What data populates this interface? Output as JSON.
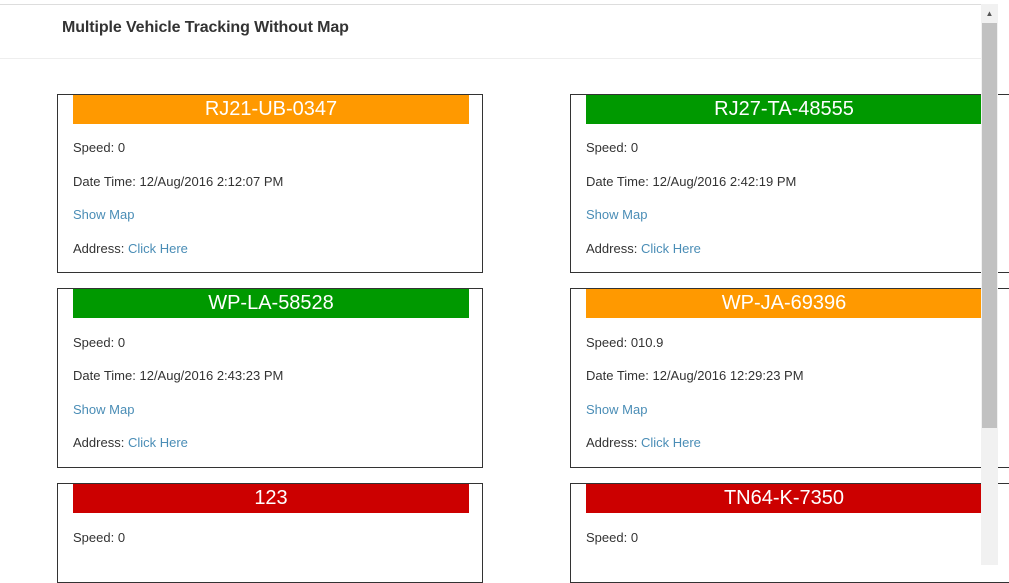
{
  "page": {
    "title": "Multiple Vehicle Tracking Without Map"
  },
  "labels": {
    "speed": "Speed:",
    "date_time": "Date Time:",
    "show_map": "Show Map",
    "address": "Address:",
    "click_here": "Click Here"
  },
  "colors": {
    "orange": "#ff9900",
    "green": "#009900",
    "red": "#cc0000",
    "link": "#4a8db6"
  },
  "vehicles": [
    {
      "id": "RJ21-UB-0347",
      "status_color": "#ff9900",
      "speed": "0",
      "date_time": "12/Aug/2016 2:12:07 PM"
    },
    {
      "id": "RJ27-TA-48555",
      "status_color": "#009900",
      "speed": "0",
      "date_time": "12/Aug/2016 2:42:19 PM"
    },
    {
      "id": "WP-LA-58528",
      "status_color": "#009900",
      "speed": "0",
      "date_time": "12/Aug/2016 2:43:23 PM"
    },
    {
      "id": "WP-JA-69396",
      "status_color": "#ff9900",
      "speed": "010.9",
      "date_time": "12/Aug/2016 12:29:23 PM"
    },
    {
      "id": "123",
      "status_color": "#cc0000",
      "speed": "0"
    },
    {
      "id": "TN64-K-7350",
      "status_color": "#cc0000",
      "speed": "0"
    }
  ],
  "scrollbar": {
    "up_icon": "triangle-up"
  }
}
